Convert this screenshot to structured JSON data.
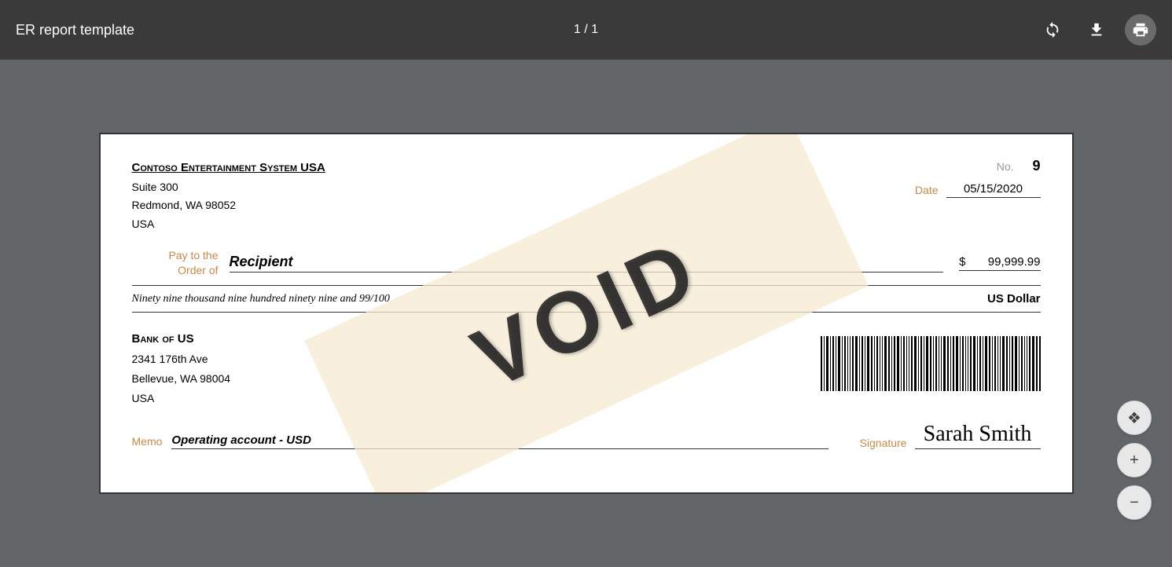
{
  "topbar": {
    "title": "ER report template",
    "page_info": "1 / 1",
    "icons": {
      "rotate": "↺",
      "download": "⬇",
      "print": "🖶"
    }
  },
  "check": {
    "company": {
      "name": "Contoso Entertainment System USA",
      "address_line1": "Suite 300",
      "address_line2": "Redmond, WA 98052",
      "address_line3": "USA"
    },
    "check_no_label": "No.",
    "check_no_value": "9",
    "date_label": "Date",
    "date_value": "05/15/2020",
    "pay_label_line1": "Pay to the",
    "pay_label_line2": "Order of",
    "recipient": "Recipient",
    "dollar_sign": "$",
    "amount": "99,999.99",
    "words_line": "Ninety nine thousand nine hundred ninety nine and 99/100",
    "currency": "US Dollar",
    "bank": {
      "name": "Bank of US",
      "address_line1": "2341 176th Ave",
      "address_line2": "Bellevue, WA 98004",
      "address_line3": "USA"
    },
    "memo_label": "Memo",
    "memo_value": "Operating account - USD",
    "signature_label": "Signature",
    "signature_name": "Sarah Smith",
    "void_text": "VOID"
  },
  "side_buttons": {
    "expand": "⊞",
    "zoom_in": "+",
    "zoom_out": "−"
  }
}
